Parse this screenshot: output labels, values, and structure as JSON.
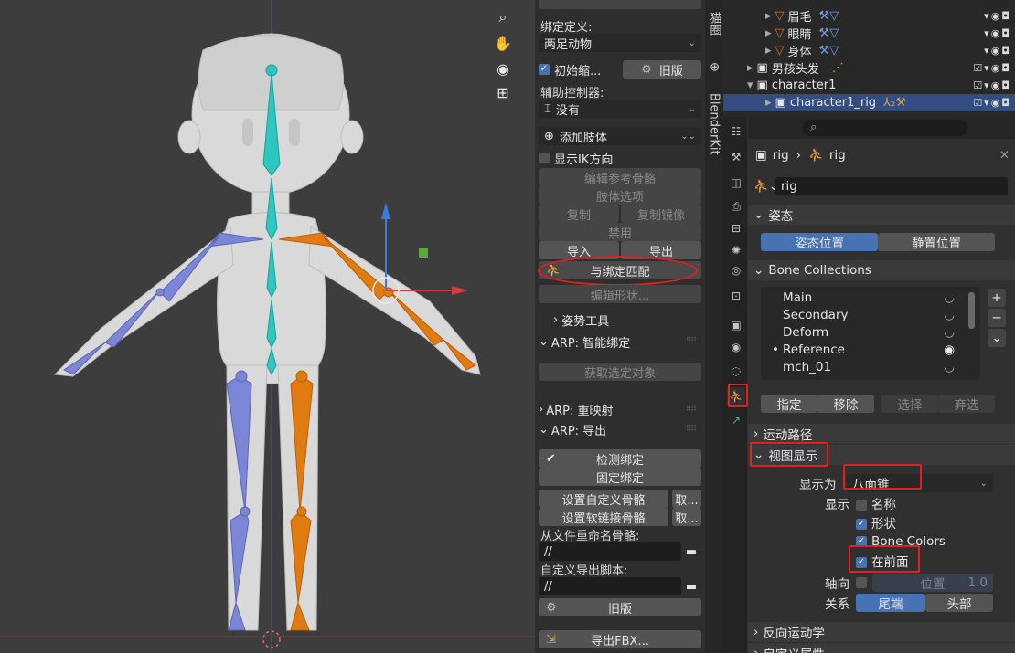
{
  "viewport": {
    "tools": [
      "zoom-icon",
      "hand-icon",
      "camera-icon",
      "grid-icon"
    ]
  },
  "arp": {
    "rig_def_label": "绑定定义:",
    "rig_def_value": "两足动物",
    "init_scale_label": "初始缩...",
    "old_version_btn": "旧版",
    "helper_label": "辅助控制器:",
    "helper_value": "没有",
    "add_limb": "添加肢体",
    "show_ik": "显示IK方向",
    "edit_ref_bones": "编辑参考骨骼",
    "limb_options": "肢体选项",
    "copy": "复制",
    "copy_mirror": "复制镜像",
    "disable": "禁用",
    "import": "导入",
    "export": "导出",
    "match_to_rig": "与绑定匹配",
    "edit_shape": "编辑形状...",
    "pose_tools": "姿势工具",
    "smart_header": "ARP: 智能绑定",
    "get_selected": "获取选定对象",
    "remap_header": "ARP: 重映射",
    "export_header": "ARP: 导出",
    "check_rig": "检测绑定",
    "fix_rig": "固定绑定",
    "set_custom_bones": "设置自定义骨骼",
    "set_soft_link": "设置软链接骨骼",
    "take": "取...",
    "rename_label": "从文件重命名骨骼:",
    "rename_path": "//",
    "custom_script_label": "自定义导出脚本:",
    "custom_script_path": "//",
    "old_version2": "旧版",
    "export_fbx": "导出FBX..."
  },
  "tabstrip": {
    "tab_top": "猫圈",
    "tab_blenderkit": "BlenderKit"
  },
  "outliner": {
    "rows": [
      {
        "label": "眉毛",
        "indent": 2
      },
      {
        "label": "眼睛",
        "indent": 2
      },
      {
        "label": "身体",
        "indent": 2
      },
      {
        "label": "男孩头发",
        "indent": 1
      },
      {
        "label": "character1",
        "indent": 1
      },
      {
        "label": "character1_rig",
        "indent": 2
      }
    ]
  },
  "props": {
    "breadcrumb_obj": "rig",
    "breadcrumb_arm": "rig",
    "armature_name": "rig",
    "pose_header": "姿态",
    "pose_position": "姿态位置",
    "rest_position": "静置位置",
    "bone_collections_header": "Bone Collections",
    "collections": [
      "Main",
      "Secondary",
      "Deform",
      "Reference",
      "mch_01"
    ],
    "assign": "指定",
    "remove": "移除",
    "select": "选择",
    "deselect": "弃选",
    "motion_paths": "运动路径",
    "viewport_display": "视图显示",
    "display_as_label": "显示为",
    "display_as_value": "八面锥",
    "show_label": "显示",
    "names": "名称",
    "shapes": "形状",
    "bone_colors": "Bone Colors",
    "in_front": "在前面",
    "axes_label": "轴向",
    "axes_position": "位置",
    "axes_value": "1.0",
    "relation_label": "关系",
    "relation_tail": "尾端",
    "relation_head": "头部",
    "inverse_kinematics": "反向运动学",
    "custom_props": "自定义属性"
  },
  "colors": {
    "accent_blue": "#4772b3",
    "left_bones": "#7b86d6",
    "right_bones": "#e07b12",
    "spine_bones": "#2ec6c1",
    "highlight_red": "#e1211c"
  }
}
